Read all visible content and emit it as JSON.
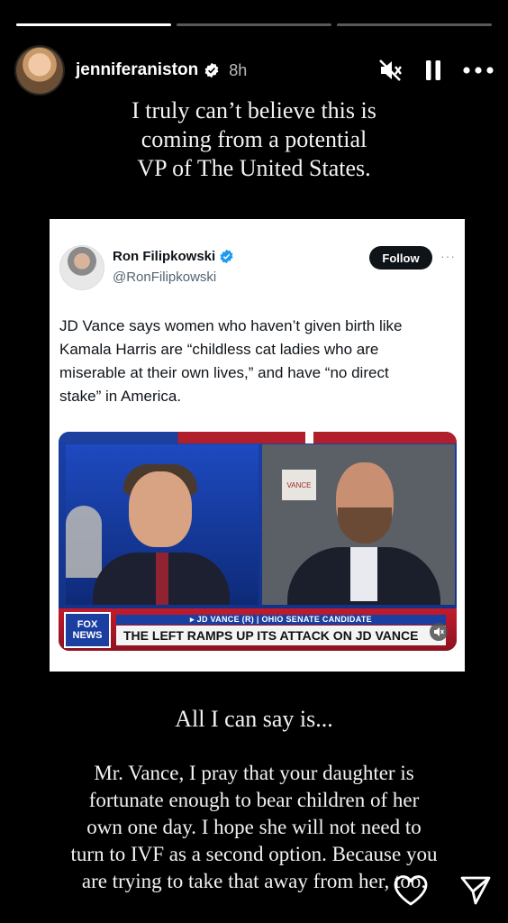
{
  "story": {
    "progress": [
      1,
      0,
      0
    ],
    "username": "jenniferaniston",
    "time": "8h"
  },
  "icons": {
    "verified": "verified-badge-icon",
    "mute": "speaker-muted-icon",
    "pause": "pause-icon",
    "more": "more-horizontal-icon",
    "like": "heart-icon",
    "share": "send-paper-plane-icon"
  },
  "caption_top": [
    "I truly can’t believe this is",
    "coming from a potential",
    "VP of The United States."
  ],
  "tweet": {
    "name": "Ron Filipkowski",
    "handle": "@RonFilipkowski",
    "follow_label": "Follow",
    "more": "···",
    "text_lines": [
      "JD Vance says women who haven’t given birth like",
      "Kamala Harris are “childless cat ladies who are",
      "miserable at their own lives,” and have “no direct",
      "stake” in America."
    ],
    "video": {
      "logo_line1": "FOX",
      "logo_line2": "NEWS",
      "wall_sign": "VANCE",
      "strap_top": "▸ JD VANCE (R) | OHIO SENATE CANDIDATE",
      "strap_main": "THE LEFT RAMPS UP ITS ATTACK ON JD VANCE"
    }
  },
  "caption_mid": "All I can say is...",
  "caption_bottom": [
    "Mr. Vance, I pray that your daughter is",
    "fortunate enough to bear children of her",
    "own one day. I hope she will not need to",
    "turn to IVF as a second option. Because you",
    "are trying to take that away from her, too."
  ],
  "colors": {
    "verified_blue": "#1d9bf0",
    "background": "#000000"
  }
}
